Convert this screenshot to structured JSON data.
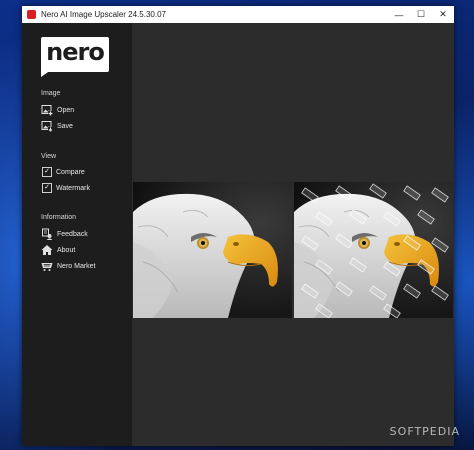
{
  "window": {
    "title": "Nero AI Image Upscaler 24.5.30.07",
    "controls": {
      "minimize": "—",
      "maximize": "☐",
      "close": "✕"
    }
  },
  "logo": {
    "text": "nero"
  },
  "sidebar": {
    "image_section": {
      "label": "Image",
      "items": [
        {
          "label": "Open",
          "icon": "open-image-icon"
        },
        {
          "label": "Save",
          "icon": "save-icon"
        }
      ]
    },
    "view_section": {
      "label": "View",
      "items": [
        {
          "label": "Compare",
          "checked": true
        },
        {
          "label": "Watermark",
          "checked": true
        }
      ]
    },
    "information_section": {
      "label": "Information",
      "items": [
        {
          "label": "Feedback",
          "icon": "feedback-icon"
        },
        {
          "label": "About",
          "icon": "home-icon"
        },
        {
          "label": "Nero Market",
          "icon": "cart-icon"
        }
      ]
    }
  },
  "preview": {
    "left_image": "eagle-original",
    "right_image": "eagle-upscaled-watermarked"
  },
  "overlay": {
    "site_watermark": "SOFTPEDIA"
  },
  "colors": {
    "sidebar_bg": "#1d1d1d",
    "main_bg": "#2c2c2c",
    "titlebar_bg": "#ffffff",
    "beak": "#e8a21c"
  }
}
